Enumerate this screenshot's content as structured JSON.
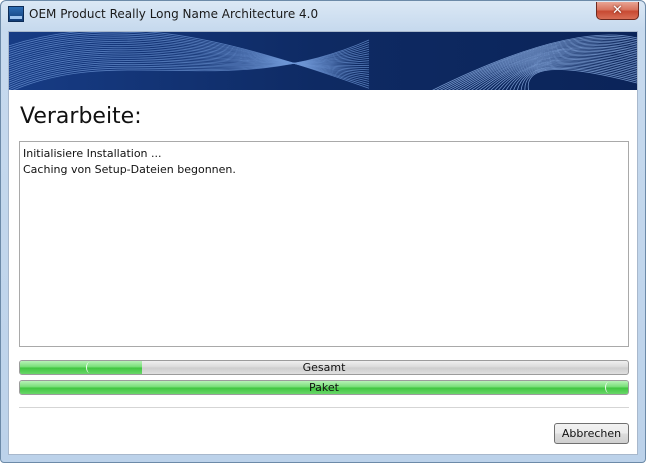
{
  "window": {
    "title": "OEM Product Really Long Name Architecture 4.0",
    "icon": "product-app-icon",
    "close_icon": "close-icon"
  },
  "page": {
    "heading": "Verarbeite:"
  },
  "log": {
    "lines": [
      "Initialisiere Installation ...",
      "Caching von Setup-Dateien begonnen."
    ]
  },
  "progress": {
    "overall": {
      "label": "Gesamt",
      "value_percent": 20
    },
    "package": {
      "label": "Paket",
      "value_percent": 100
    }
  },
  "buttons": {
    "cancel_label": "Abbrechen"
  },
  "colors": {
    "banner_bg": "#0e2a63",
    "progress_green": "#4ccc4c",
    "close_button_red": "#c84a33"
  }
}
